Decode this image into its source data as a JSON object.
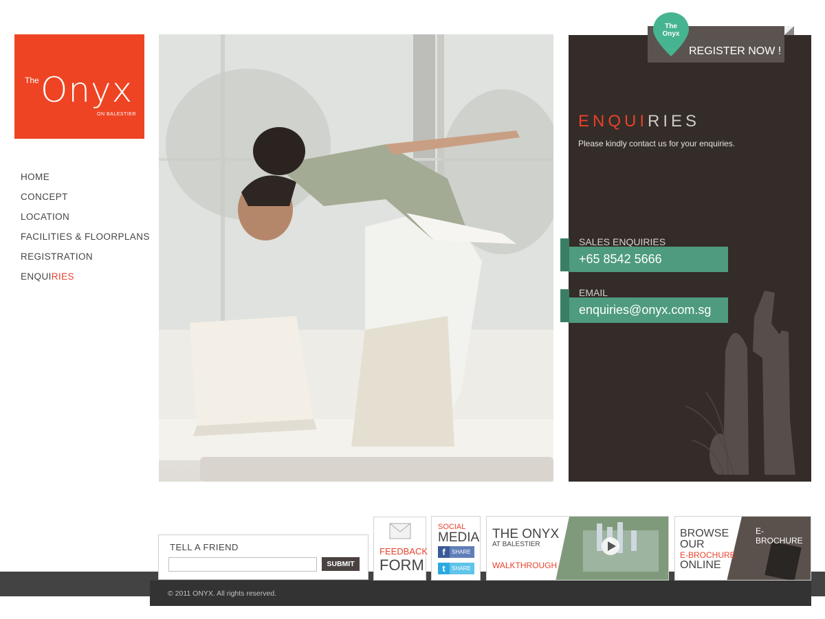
{
  "logo": {
    "the": "The",
    "name": "Onyx",
    "sub": "ON BALESTIER"
  },
  "nav": {
    "items": [
      {
        "label": "HOME"
      },
      {
        "label": "CONCEPT"
      },
      {
        "label": "LOCATION"
      },
      {
        "label": "FACILITIES & FLOORPLANS"
      },
      {
        "label": "REGISTRATION"
      },
      {
        "label_main": "ENQUI",
        "label_accent": "RIES",
        "active": true
      }
    ]
  },
  "register": {
    "pin_label": "The Onyx",
    "label": "REGISTER NOW !"
  },
  "enquiries": {
    "title_accent": "ENQUI",
    "title_rest": "RIES",
    "description": "Please kindly contact us for your enquiries.",
    "sales": {
      "label": "SALES ENQUIRIES",
      "value": "+65 8542 5666"
    },
    "email": {
      "label": "EMAIL",
      "value": "enquiries@onyx.com.sg"
    }
  },
  "tell_a_friend": {
    "label": "TELL A FRIEND",
    "input_value": "",
    "submit": "SUBMIT"
  },
  "feedback": {
    "line1": "FEEDBACK",
    "line2": "FORM"
  },
  "social": {
    "line1": "SOCIAL",
    "line2": "MEDIA",
    "facebook_share": "SHARE",
    "twitter_share": "SHARE"
  },
  "walkthrough": {
    "line1": "THE ONYX",
    "line2": "AT BALESTIER",
    "line3": "WALKTHROUGH"
  },
  "ebrochure": {
    "line1": "BROWSE",
    "line2": "OUR",
    "line3": "E-BROCHURE",
    "line4": "ONLINE",
    "badge": "E-BROCHURE"
  },
  "footer": {
    "copyright": "© 2011 ONYX. All rights reserved."
  },
  "colors": {
    "brand": "#ee4423",
    "accent_red": "#e8412b",
    "teal": "#4e9b7f",
    "panel": "#342c28"
  }
}
